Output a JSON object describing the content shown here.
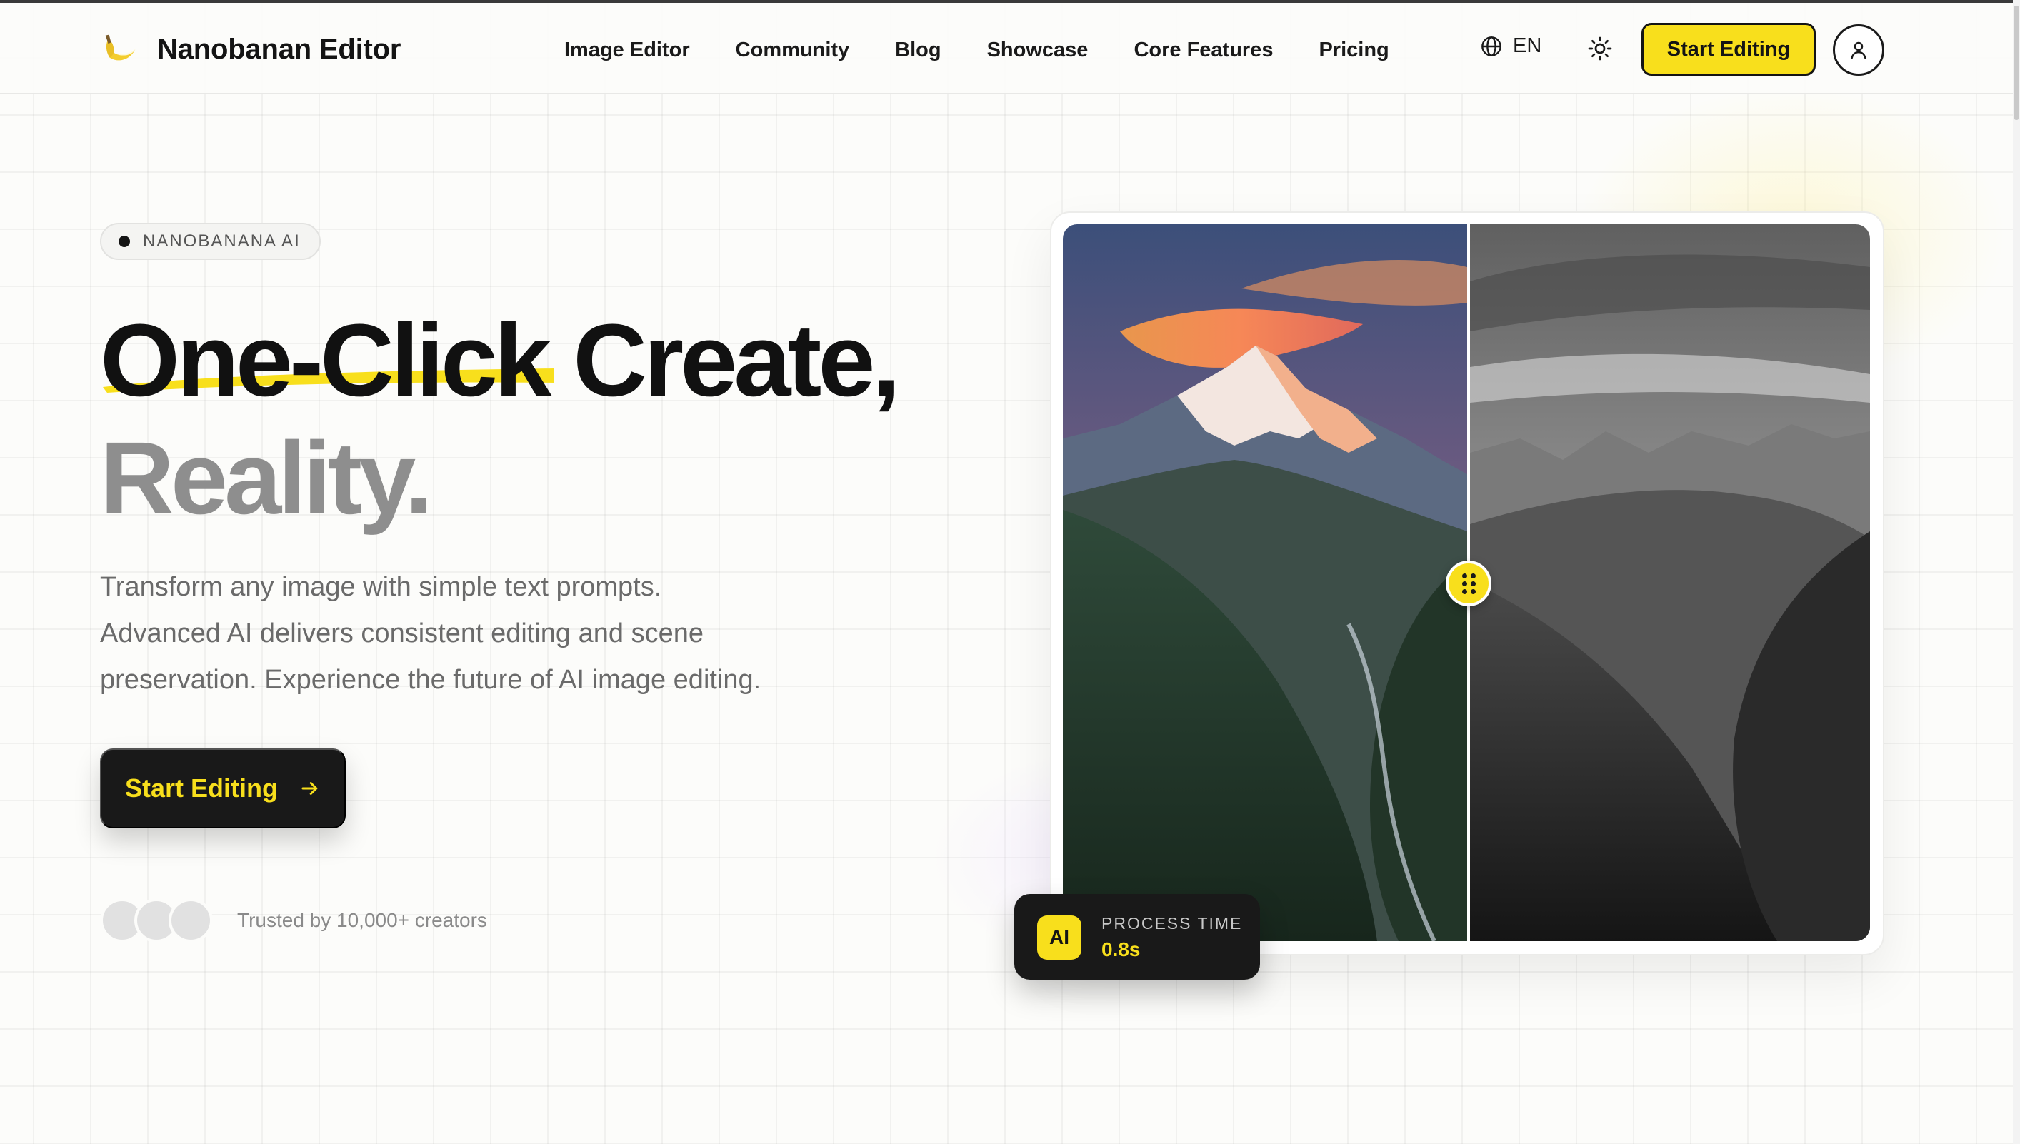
{
  "header": {
    "brand": "Nanobanan Editor",
    "logo_icon": "banana-icon",
    "nav": [
      {
        "label": "Image Editor"
      },
      {
        "label": "Community"
      },
      {
        "label": "Blog"
      },
      {
        "label": "Showcase"
      },
      {
        "label": "Core Features"
      },
      {
        "label": "Pricing"
      }
    ],
    "language": "EN",
    "language_icon": "globe-icon",
    "theme_icon": "sun-icon",
    "cta_label": "Start Editing",
    "account_icon": "user-icon"
  },
  "hero": {
    "badge": "NANOBANANA AI",
    "headline_highlight": "One-Click",
    "headline_rest": " Create,",
    "headline_line2": "Reality.",
    "description": [
      "Transform any image with simple text prompts.",
      "Advanced AI delivers consistent editing and scene",
      "preservation. Experience the future of AI image editing."
    ],
    "cta_label": "Start Editing",
    "cta_icon": "arrow-right-icon",
    "trusted_text": "Trusted by 10,000+ creators"
  },
  "comparison": {
    "before_label": "color mountain photo",
    "after_label": "grayscale mountain photo",
    "slider_position": 0.5,
    "process_chip": "AI",
    "process_label": "PROCESS TIME",
    "process_value": "0.8s"
  },
  "colors": {
    "accent_yellow": "#f8df1c",
    "dark": "#191919",
    "background": "#fcfcfa"
  }
}
